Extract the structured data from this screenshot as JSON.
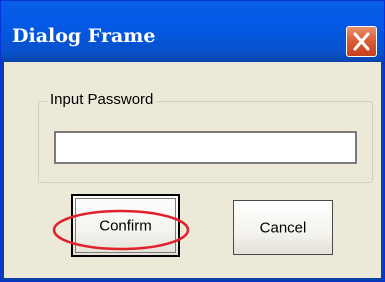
{
  "window": {
    "title": "Dialog Frame",
    "close_icon": "close-icon"
  },
  "group": {
    "label": "Input Password"
  },
  "password": {
    "value": "",
    "placeholder": ""
  },
  "buttons": {
    "confirm_label": "Confirm",
    "cancel_label": "Cancel"
  },
  "colors": {
    "title_bar": "#0359e6",
    "close_button": "#d85a32",
    "dialog_background": "#ece9d8",
    "highlight_ring": "#e0202a"
  }
}
